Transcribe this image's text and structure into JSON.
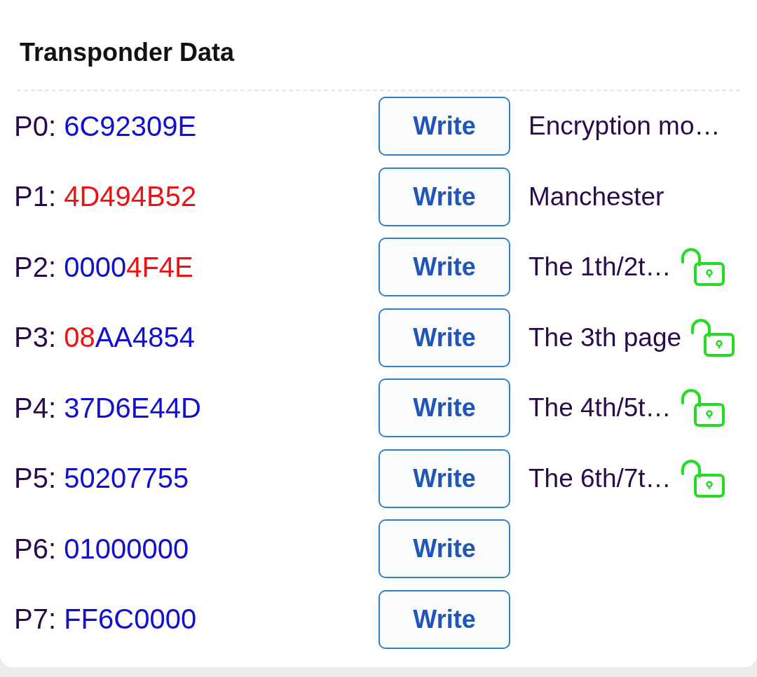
{
  "title": "Transponder Data",
  "rows": [
    {
      "label": "P0:",
      "segments": [
        {
          "text": "6C92309E",
          "color": "#1010d0"
        }
      ],
      "button": "Write",
      "note": "Encryption mo…"
    },
    {
      "label": "P1:",
      "segments": [
        {
          "text": "4D494B52",
          "color": "#ee1111"
        }
      ],
      "button": "Write",
      "note": "Manchester"
    },
    {
      "label": "P2:",
      "segments": [
        {
          "text": "0000",
          "color": "#1010d0"
        },
        {
          "text": "4F4E",
          "color": "#ee1111"
        }
      ],
      "button": "Write",
      "note": "The 1th/2t…",
      "unlocked": true
    },
    {
      "label": "P3:",
      "segments": [
        {
          "text": "08",
          "color": "#ee1111"
        },
        {
          "text": "AA4854",
          "color": "#1010d0"
        }
      ],
      "button": "Write",
      "note": "The 3th page",
      "unlocked": true
    },
    {
      "label": "P4:",
      "segments": [
        {
          "text": "37D6E44D",
          "color": "#1010d0"
        }
      ],
      "button": "Write",
      "note": "The 4th/5t…",
      "unlocked": true
    },
    {
      "label": "P5:",
      "segments": [
        {
          "text": "50207755",
          "color": "#1010d0"
        }
      ],
      "button": "Write",
      "note": "The 6th/7t…",
      "unlocked": true
    },
    {
      "label": "P6:",
      "segments": [
        {
          "text": "01000000",
          "color": "#1010d0"
        }
      ],
      "button": "Write"
    },
    {
      "label": "P7:",
      "segments": [
        {
          "text": "FF6C0000",
          "color": "#1010d0"
        }
      ],
      "button": "Write"
    }
  ]
}
